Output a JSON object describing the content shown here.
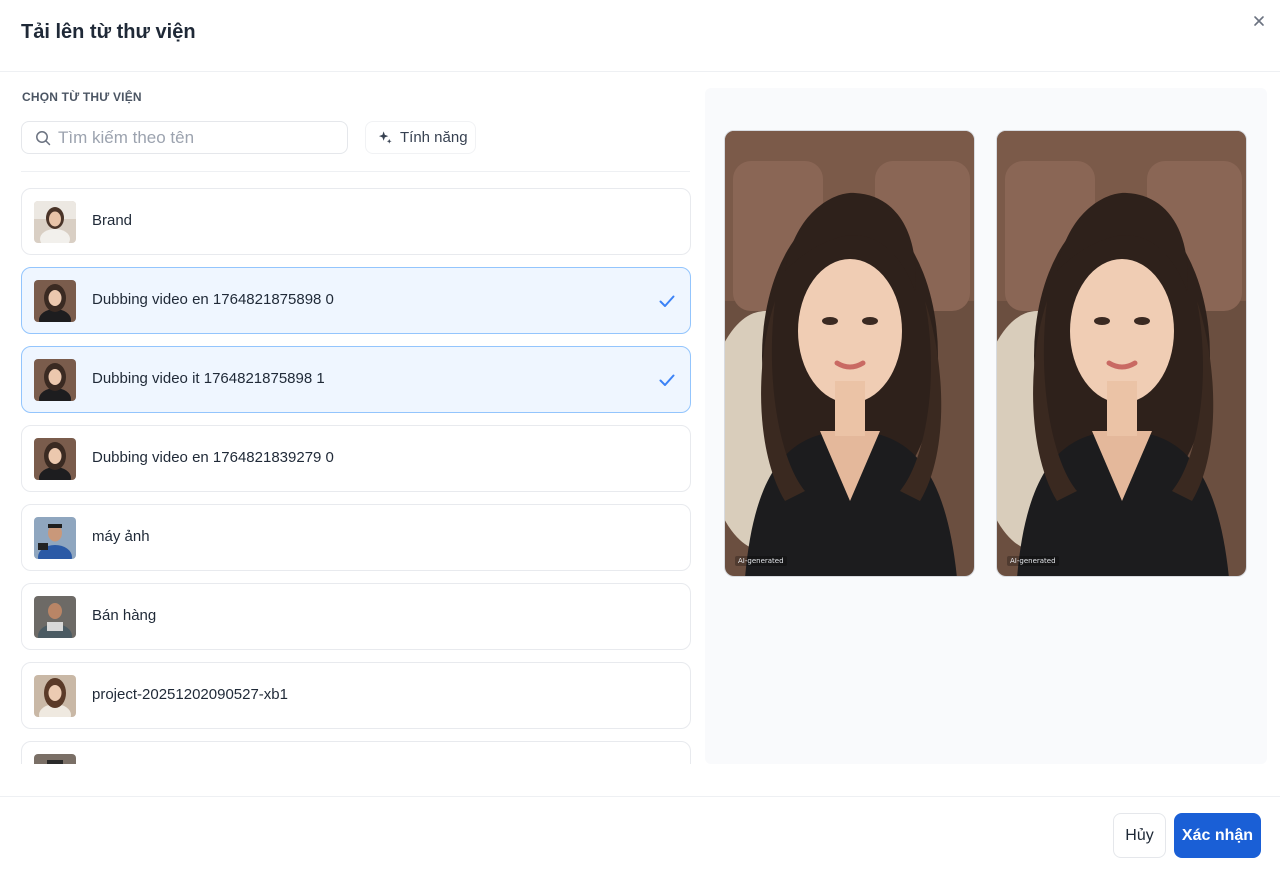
{
  "dialog": {
    "title": "Tải lên từ thư viện",
    "close_icon": "close-icon"
  },
  "library": {
    "section_label": "CHỌN TỪ THƯ VIỆN",
    "search": {
      "placeholder": "Tìm kiếm theo tên",
      "value": ""
    },
    "feature_button": {
      "label": "Tính năng",
      "icon": "sparkle-icon"
    },
    "items": [
      {
        "label": "Brand",
        "selected": false
      },
      {
        "label": "Dubbing video en 1764821875898 0",
        "selected": true
      },
      {
        "label": "Dubbing video it 1764821875898 1",
        "selected": true
      },
      {
        "label": "Dubbing video en 1764821839279 0",
        "selected": false
      },
      {
        "label": "máy ảnh",
        "selected": false
      },
      {
        "label": "Bán hàng",
        "selected": false
      },
      {
        "label": "project-20251202090527-xb1",
        "selected": false
      },
      {
        "label": "",
        "selected": false
      }
    ]
  },
  "preview": {
    "images": [
      {
        "badge": "AI-generated"
      },
      {
        "badge": "AI-generated"
      }
    ]
  },
  "footer": {
    "cancel_label": "Hủy",
    "confirm_label": "Xác nhận"
  },
  "colors": {
    "accent": "#1a5fd6",
    "selected_bg": "#eff6ff",
    "selected_border": "#93c5fd",
    "check": "#3b82f6"
  }
}
